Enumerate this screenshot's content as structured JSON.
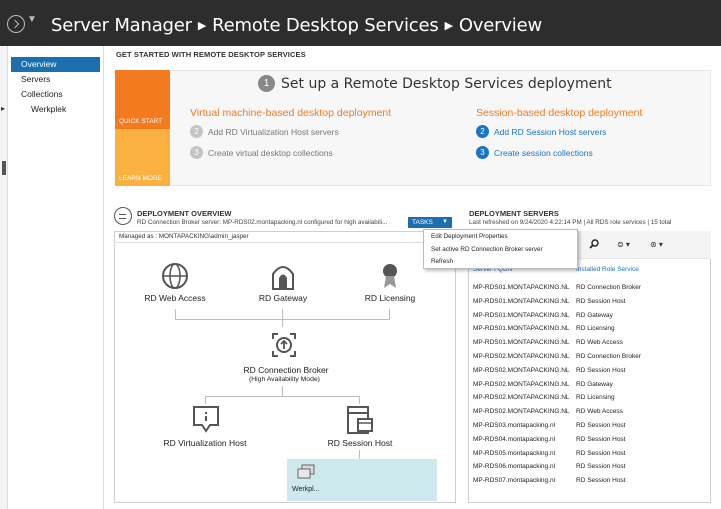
{
  "header": {
    "breadcrumbs": [
      "Server Manager",
      "Remote Desktop Services",
      "Overview"
    ]
  },
  "nav": {
    "items": [
      {
        "label": "Overview",
        "active": true
      },
      {
        "label": "Servers",
        "active": false
      },
      {
        "label": "Collections",
        "active": false
      },
      {
        "label": "Werkplek",
        "active": false
      }
    ]
  },
  "get_started": {
    "title": "GET STARTED WITH REMOTE DESKTOP SERVICES",
    "quick_start": "QUICK START",
    "learn_more": "LEARN MORE",
    "step1": {
      "number": "1",
      "text": "Set up a Remote Desktop Services deployment"
    },
    "vm_column": {
      "heading": "Virtual machine-based desktop deployment",
      "steps": [
        {
          "number": "2",
          "text": "Add RD Virtualization Host servers"
        },
        {
          "number": "3",
          "text": "Create virtual desktop collections"
        }
      ]
    },
    "session_column": {
      "heading": "Session-based desktop deployment",
      "steps": [
        {
          "number": "2",
          "text": "Add RD Session Host servers"
        },
        {
          "number": "3",
          "text": "Create session collections"
        }
      ]
    }
  },
  "deployment_overview": {
    "title": "DEPLOYMENT OVERVIEW",
    "subtitle": "RD Connection Broker server: MP-RDS02.montapacking.nl configured for high availabili...",
    "tasks_label": "TASKS",
    "managed_as": "Managed as : MONTAPACKING\\admin_jasper",
    "nodes": {
      "web_access": "RD Web Access",
      "gateway": "RD Gateway",
      "licensing": "RD Licensing",
      "connection_broker": "RD Connection Broker",
      "connection_broker_mode": "(High Availability Mode)",
      "virtualization_host": "RD Virtualization Host",
      "session_host": "RD Session Host",
      "collection": "Werkpl..."
    }
  },
  "tasks_menu": {
    "items": [
      "Edit Deployment Properties",
      "Set active RD Connection Broker server",
      "Refresh"
    ]
  },
  "deployment_servers": {
    "title": "DEPLOYMENT SERVERS",
    "subtitle": "Last refreshed on 9/24/2020 4:22:14 PM | All RDS role services | 15 total",
    "columns": [
      "Server FQDN",
      "Installed Role Service"
    ],
    "rows": [
      {
        "fqdn": "MP-RDS01.MONTAPACKING.NL",
        "role": "RD Connection Broker"
      },
      {
        "fqdn": "MP-RDS01.MONTAPACKING.NL",
        "role": "RD Session Host"
      },
      {
        "fqdn": "MP-RDS01.MONTAPACKING.NL",
        "role": "RD Gateway"
      },
      {
        "fqdn": "MP-RDS01.MONTAPACKING.NL",
        "role": "RD Licensing"
      },
      {
        "fqdn": "MP-RDS01.MONTAPACKING.NL",
        "role": "RD Web Access"
      },
      {
        "fqdn": "MP-RDS02.MONTAPACKING.NL",
        "role": "RD Connection Broker"
      },
      {
        "fqdn": "MP-RDS02.MONTAPACKING.NL",
        "role": "RD Session Host"
      },
      {
        "fqdn": "MP-RDS02.MONTAPACKING.NL",
        "role": "RD Gateway"
      },
      {
        "fqdn": "MP-RDS02.MONTAPACKING.NL",
        "role": "RD Licensing"
      },
      {
        "fqdn": "MP-RDS02.MONTAPACKING.NL",
        "role": "RD Web Access"
      },
      {
        "fqdn": "MP-RDS03.montapacking.nl",
        "role": "RD Session Host"
      },
      {
        "fqdn": "MP-RDS04.montapacking.nl",
        "role": "RD Session Host"
      },
      {
        "fqdn": "MP-RDS05.montapacking.nl",
        "role": "RD Session Host"
      },
      {
        "fqdn": "MP-RDS06.montapacking.nl",
        "role": "RD Session Host"
      },
      {
        "fqdn": "MP-RDS07.montapacking.nl",
        "role": "RD Session Host"
      }
    ]
  },
  "colors": {
    "titlebar": "#2d2d2d",
    "accent_blue": "#1a6fb0",
    "quick_start_orange": "#f47a20",
    "learn_more_amber": "#fbb140",
    "collection_tile": "#cde9ee"
  }
}
